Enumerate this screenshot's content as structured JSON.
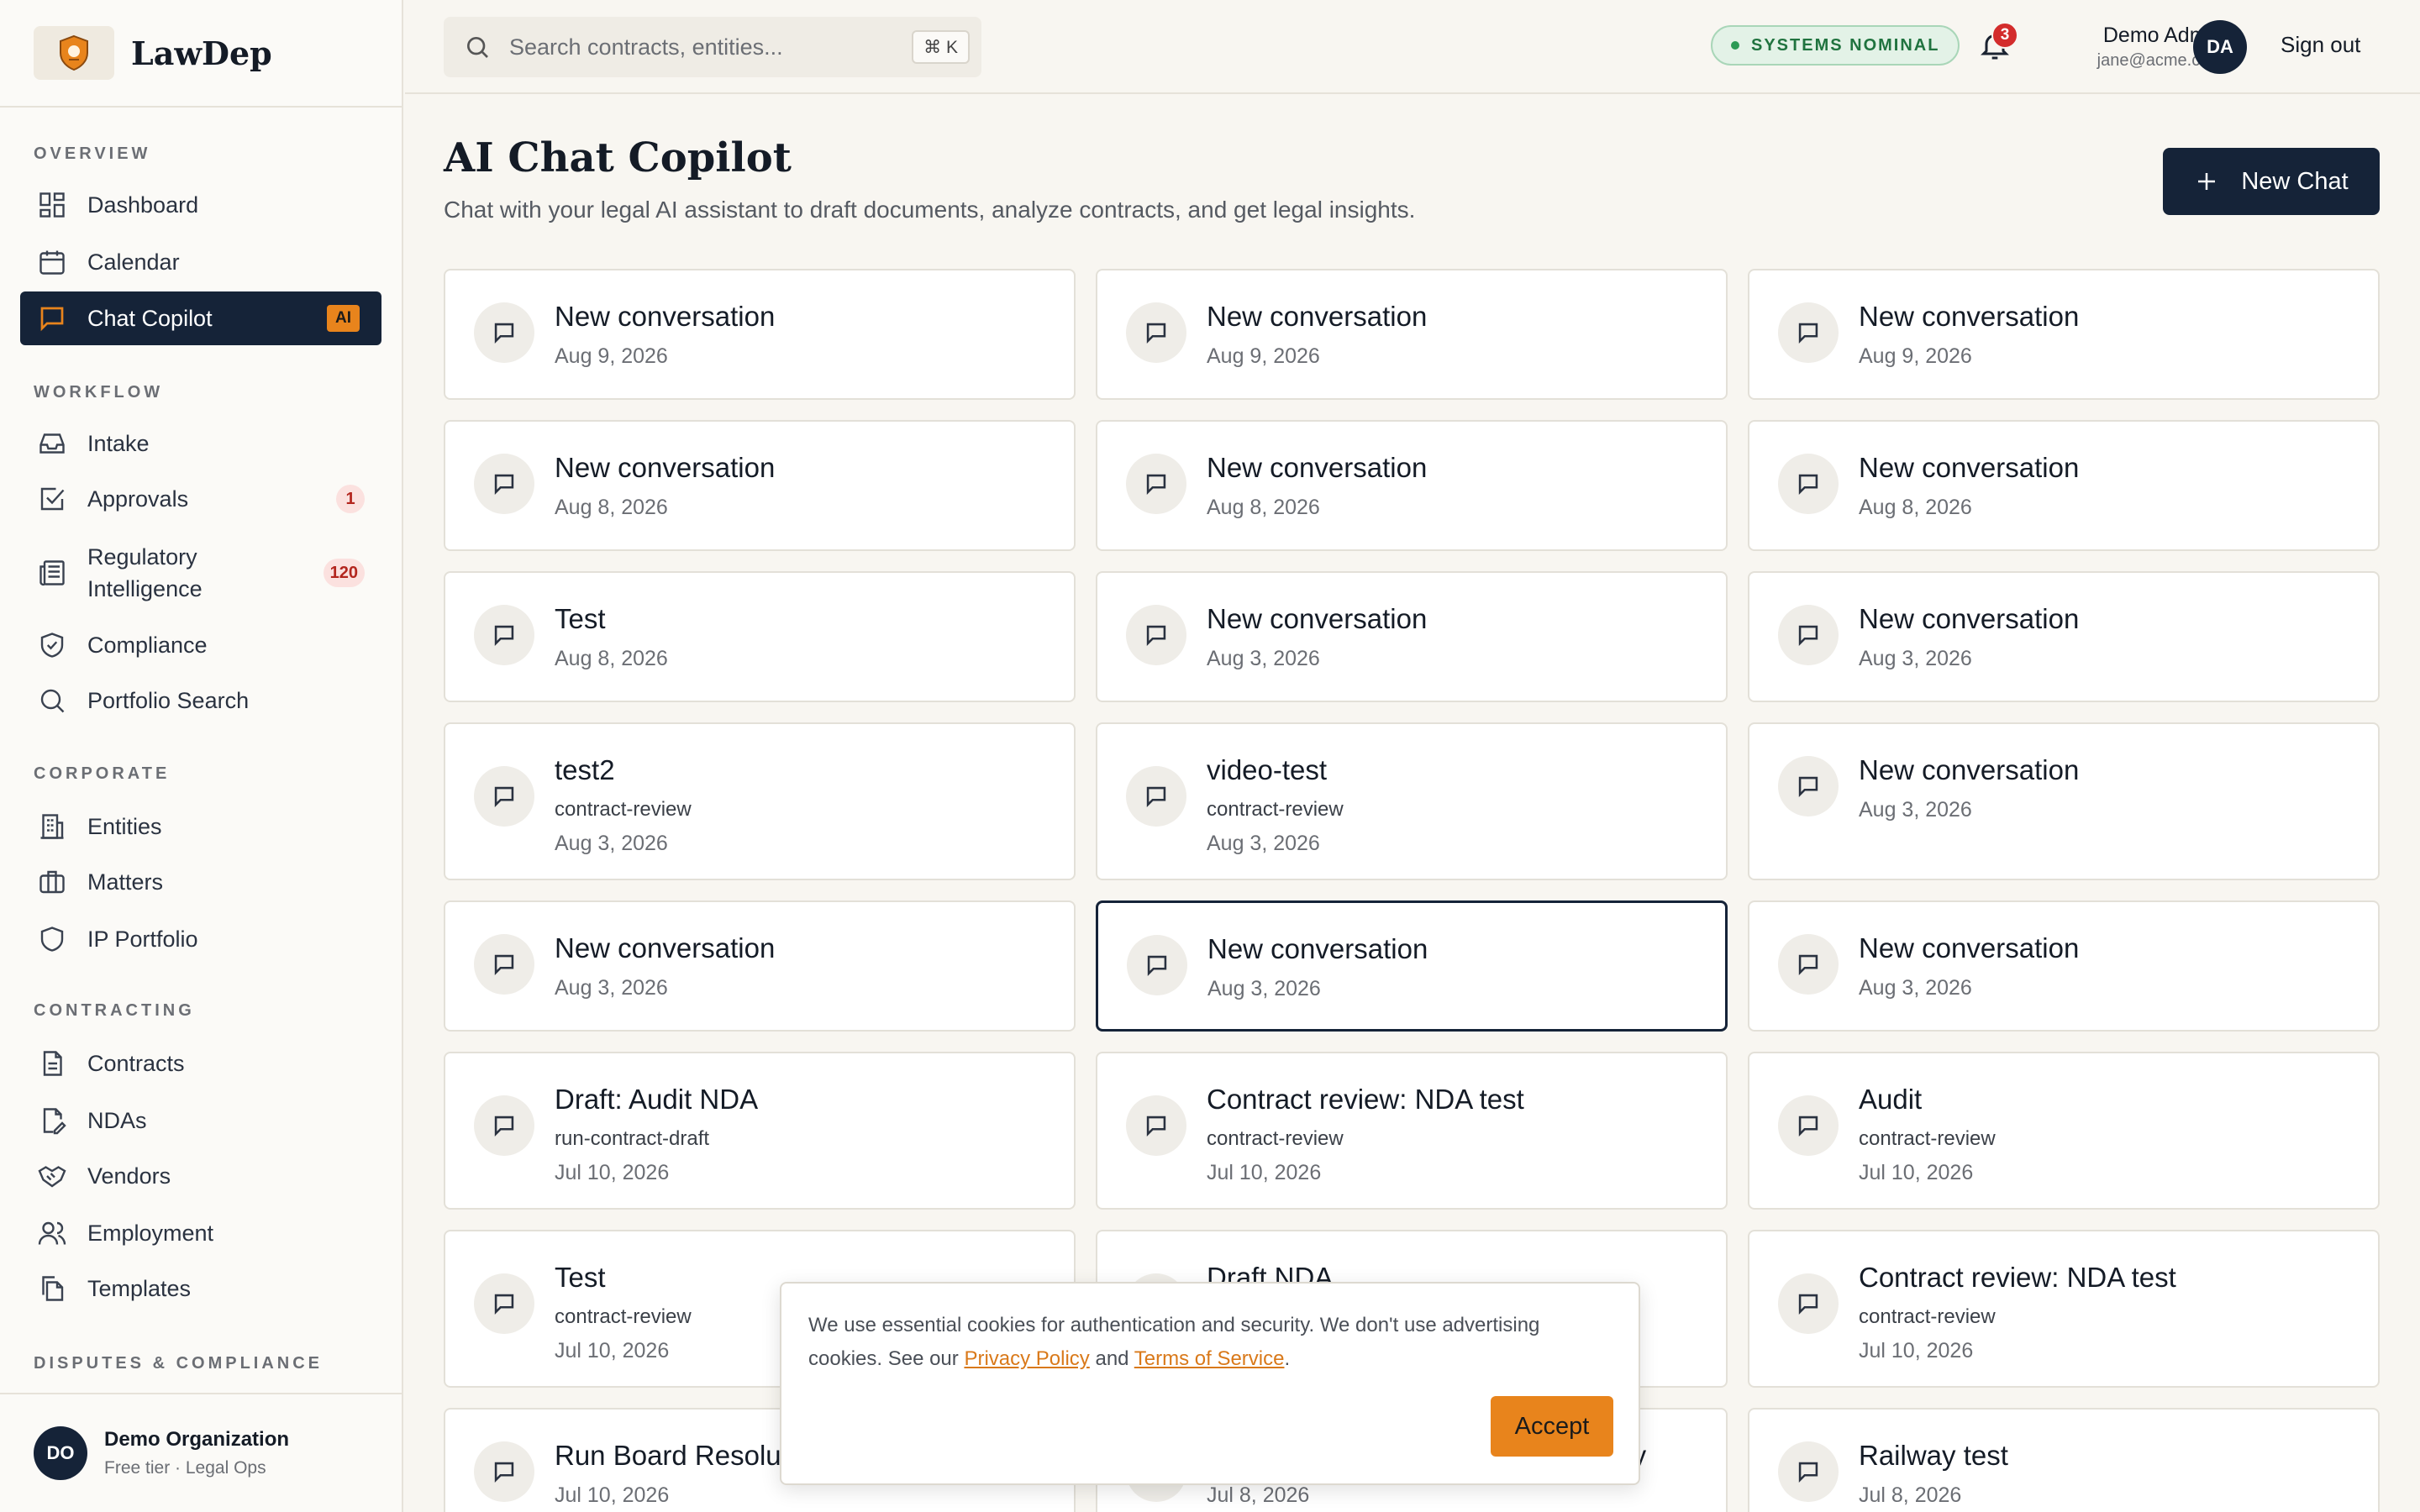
{
  "brand": {
    "name": "LawDep"
  },
  "sidebar": {
    "sections": [
      "OVERVIEW",
      "WORKFLOW",
      "CORPORATE",
      "CONTRACTING",
      "DISPUTES & COMPLIANCE"
    ],
    "items": [
      {
        "label": "Dashboard",
        "icon": "dashboard-icon"
      },
      {
        "label": "Calendar",
        "icon": "calendar-icon"
      },
      {
        "label": "Chat Copilot",
        "icon": "chat-icon",
        "tag": "AI",
        "active": true
      },
      {
        "label": "Intake",
        "icon": "inbox-icon"
      },
      {
        "label": "Approvals",
        "icon": "check-square-icon",
        "count": "1"
      },
      {
        "label": "Regulatory",
        "label2": "Intelligence",
        "icon": "newspaper-icon",
        "count": "120"
      },
      {
        "label": "Compliance",
        "icon": "shield-check-icon"
      },
      {
        "label": "Portfolio Search",
        "icon": "search-icon"
      },
      {
        "label": "Entities",
        "icon": "building-icon"
      },
      {
        "label": "Matters",
        "icon": "briefcase-icon"
      },
      {
        "label": "IP Portfolio",
        "icon": "shield-icon"
      },
      {
        "label": "Contracts",
        "icon": "file-text-icon"
      },
      {
        "label": "NDAs",
        "icon": "file-pen-icon"
      },
      {
        "label": "Vendors",
        "icon": "handshake-icon"
      },
      {
        "label": "Employment",
        "icon": "users-icon"
      },
      {
        "label": "Templates",
        "icon": "files-icon"
      }
    ],
    "org": {
      "initials": "DO",
      "name": "Demo Organization",
      "sub": "Free tier · Legal Ops"
    }
  },
  "topbar": {
    "search_placeholder": "Search contracts, entities...",
    "shortcut": "⌘ K",
    "status": "SYSTEMS NOMINAL",
    "notifications": "3",
    "user": {
      "name": "Demo Admin",
      "email": "jane@acme.com",
      "initials": "DA"
    },
    "signout": "Sign out"
  },
  "main": {
    "title": "AI Chat Copilot",
    "subtitle": "Chat with your legal AI assistant to draft documents, analyze contracts, and get legal insights.",
    "new_chat": "New Chat",
    "cards": [
      {
        "title": "New conversation",
        "date": "Aug 9, 2026"
      },
      {
        "title": "New conversation",
        "date": "Aug 9, 2026"
      },
      {
        "title": "New conversation",
        "date": "Aug 9, 2026"
      },
      {
        "title": "New conversation",
        "date": "Aug 8, 2026"
      },
      {
        "title": "New conversation",
        "date": "Aug 8, 2026"
      },
      {
        "title": "New conversation",
        "date": "Aug 8, 2026"
      },
      {
        "title": "Test",
        "date": "Aug 8, 2026"
      },
      {
        "title": "New conversation",
        "date": "Aug 3, 2026"
      },
      {
        "title": "New conversation",
        "date": "Aug 3, 2026"
      },
      {
        "title": "test2",
        "sub": "contract-review",
        "date": "Aug 3, 2026"
      },
      {
        "title": "video-test",
        "sub": "contract-review",
        "date": "Aug 3, 2026"
      },
      {
        "title": "New conversation",
        "date": "Aug 3, 2026"
      },
      {
        "title": "New conversation",
        "date": "Aug 3, 2026"
      },
      {
        "title": "New conversation",
        "date": "Aug 3, 2026",
        "selected": true
      },
      {
        "title": "New conversation",
        "date": "Aug 3, 2026"
      },
      {
        "title": "Draft: Audit NDA",
        "sub": "run-contract-draft",
        "date": "Jul 10, 2026"
      },
      {
        "title": "Contract review: NDA test",
        "sub": "contract-review",
        "date": "Jul 10, 2026"
      },
      {
        "title": "Audit",
        "sub": "contract-review",
        "date": "Jul 10, 2026"
      },
      {
        "title": "Test",
        "sub": "contract-review",
        "date": "Jul 10, 2026"
      },
      {
        "title": "Draft NDA",
        "sub": "",
        "date": ""
      },
      {
        "title": "Contract review: NDA test",
        "sub": "contract-review",
        "date": "Jul 10, 2026"
      },
      {
        "title": "Run Board Resolu",
        "date": "Jul 10, 2026"
      },
      {
        "title": "uiry",
        "date": "Jul 8, 2026"
      },
      {
        "title": "Railway test",
        "date": "Jul 8, 2026"
      }
    ]
  },
  "cookie": {
    "text1": "We use essential cookies for authentication and security. We don't use advertising cookies. See our ",
    "privacy": "Privacy Policy",
    "and": " and ",
    "terms": "Terms of Service",
    "end": ".",
    "accept": "Accept"
  }
}
